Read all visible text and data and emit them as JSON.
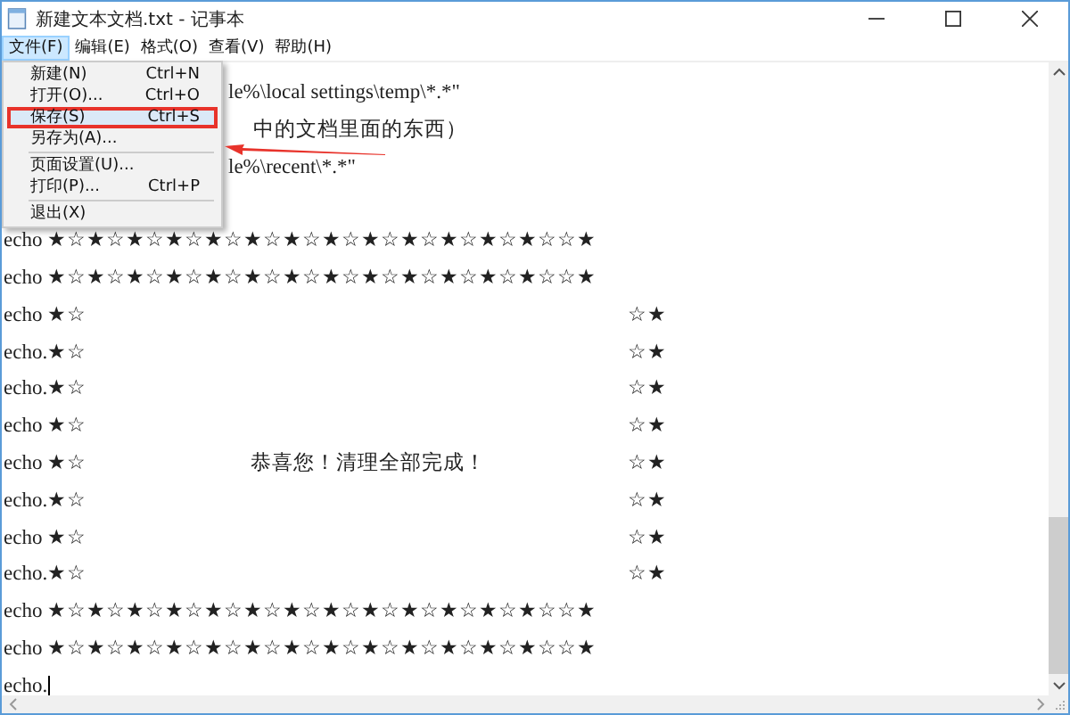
{
  "window": {
    "title": "新建文本文档.txt - 记事本"
  },
  "menubar": [
    {
      "label": "文件(F)",
      "selected": true
    },
    {
      "label": "编辑(E)",
      "selected": false
    },
    {
      "label": "格式(O)",
      "selected": false
    },
    {
      "label": "查看(V)",
      "selected": false
    },
    {
      "label": "帮助(H)",
      "selected": false
    }
  ],
  "file_menu": [
    {
      "kind": "item",
      "label": "新建(N)",
      "shortcut": "Ctrl+N",
      "selected": false,
      "marked": false
    },
    {
      "kind": "item",
      "label": "打开(O)...",
      "shortcut": "Ctrl+O",
      "selected": false,
      "marked": false
    },
    {
      "kind": "item",
      "label": "保存(S)",
      "shortcut": "Ctrl+S",
      "selected": true,
      "marked": true
    },
    {
      "kind": "item",
      "label": "另存为(A)...",
      "selected": false,
      "marked": false
    },
    {
      "kind": "separator"
    },
    {
      "kind": "item",
      "label": "页面设置(U)...",
      "selected": false,
      "marked": false
    },
    {
      "kind": "item",
      "label": "打印(P)...",
      "shortcut": "Ctrl+P",
      "selected": false,
      "marked": false
    },
    {
      "kind": "separator"
    },
    {
      "kind": "item",
      "label": "退出(X)",
      "selected": false,
      "marked": false
    }
  ],
  "editor": {
    "lines": [
      {
        "kind": "partial",
        "text": "le%\\local settings\\temp\\*.*\""
      },
      {
        "kind": "shifted",
        "text": "中的文档里面的东西）"
      },
      {
        "kind": "partial",
        "text": "le%\\recent\\*.*\""
      },
      {
        "kind": "blank"
      },
      {
        "kind": "full",
        "text": "echo ★☆★☆★☆★☆★☆★☆★☆★☆★☆★☆★☆★☆★☆☆★"
      },
      {
        "kind": "full",
        "text": "echo ★☆★☆★☆★☆★☆★☆★☆★☆★☆★☆★☆★☆★☆☆★"
      },
      {
        "kind": "side",
        "left": "echo ★☆",
        "right": "☆★"
      },
      {
        "kind": "side",
        "left": "echo.★☆",
        "right": "☆★"
      },
      {
        "kind": "side",
        "left": "echo.★☆",
        "right": "☆★"
      },
      {
        "kind": "side",
        "left": "echo ★☆",
        "right": "☆★"
      },
      {
        "kind": "side",
        "left": "echo ★☆",
        "middle": "恭喜您！清理全部完成！",
        "right": "☆★"
      },
      {
        "kind": "side",
        "left": "echo.★☆",
        "right": "☆★"
      },
      {
        "kind": "side",
        "left": "echo ★☆",
        "right": "☆★"
      },
      {
        "kind": "side",
        "left": "echo.★☆",
        "right": "☆★"
      },
      {
        "kind": "full",
        "text": "echo ★☆★☆★☆★☆★☆★☆★☆★☆★☆★☆★☆★☆★☆☆★"
      },
      {
        "kind": "full",
        "text": "echo ★☆★☆★☆★☆★☆★☆★☆★☆★☆★☆★☆★☆★☆☆★"
      },
      {
        "kind": "cursor",
        "text": "echo."
      }
    ]
  }
}
